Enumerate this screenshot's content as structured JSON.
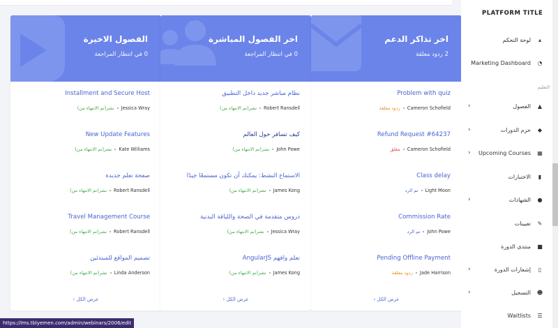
{
  "sidebar": {
    "title": "PLATFORM TITLE",
    "section_label": "التعليم",
    "items": [
      {
        "label": "لوحة التحكم",
        "icon": "dashboard-icon",
        "chevron": false
      },
      {
        "label": "Marketing Dashboard",
        "icon": "pie-chart-icon",
        "chevron": false
      },
      {
        "label": "الفصول",
        "icon": "graduation-cap-icon",
        "chevron": true
      },
      {
        "label": "حزم الدورات",
        "icon": "cube-icon",
        "chevron": true
      },
      {
        "label": "Upcoming Courses",
        "icon": "calendar-icon",
        "chevron": true
      },
      {
        "label": "الاختبارات",
        "icon": "file-icon",
        "chevron": false
      },
      {
        "label": "الشهادات",
        "icon": "certificate-icon",
        "chevron": true
      },
      {
        "label": "تعيينات",
        "icon": "pen-icon",
        "chevron": false
      },
      {
        "label": "منتدى الدورة",
        "icon": "comment-icon",
        "chevron": false
      },
      {
        "label": "إشعارات الدورة",
        "icon": "clipboard-icon",
        "chevron": true
      },
      {
        "label": "التسجيل",
        "icon": "user-plus-icon",
        "chevron": true
      },
      {
        "label": "Waitlists",
        "icon": "list-icon",
        "chevron": false
      }
    ]
  },
  "cards": [
    {
      "title": "اخر تذاكر الدعم",
      "subtitle": "2 ردود معلقة",
      "deco_icon": "envelope-icon",
      "view_all": "عرض الكل",
      "items": [
        {
          "title": "Problem with quiz",
          "person": "Cameron Schofield",
          "status": "ردود معلقة",
          "status_class": "st-orange"
        },
        {
          "title": "Refund Request #64237",
          "person": "Cameron Schofield",
          "status": "مغلق",
          "status_class": "st-red"
        },
        {
          "title": "Class delay",
          "person": "Light Moon",
          "status": "تم الرد",
          "status_class": "st-blue"
        },
        {
          "title": "Commission Rate",
          "person": "John Powe",
          "status": "تم الرد",
          "status_class": "st-blue"
        },
        {
          "title": "Pending Offline Payment",
          "person": "Jade Harrison",
          "status": "ردود معلقة",
          "status_class": "st-orange"
        }
      ]
    },
    {
      "title": "اخر الفصول المباشرة",
      "subtitle": "0 في انتظار المراجعة",
      "deco_icon": "users-icon",
      "view_all": "عرض الكل",
      "items": [
        {
          "title": "نظام مباشر جديد داخل التطبيق",
          "person": "Robert Ransdell",
          "status": "نشر(تم الانتهاء من)",
          "status_class": "st-green"
        },
        {
          "title": "كيف تسافر حول العالم",
          "person": "John Powe",
          "status": "نشر(تم الانتهاء من)",
          "status_class": "st-green"
        },
        {
          "title": "الاستماع النشط: يمكنك أن تكون مستمعًا جيدًا",
          "person": "James Kong",
          "status": "نشر(تم الانتهاء من)",
          "status_class": "st-green"
        },
        {
          "title": "دروس متقدمة في الصحة واللياقة البدنية",
          "person": "Jessica Wray",
          "status": "نشر(تم الانتهاء من)",
          "status_class": "st-green"
        },
        {
          "title": "تعلم وافهم AngularJS",
          "person": "James Kong",
          "status": "نشر(تم الانتهاء من)",
          "status_class": "st-green"
        }
      ]
    },
    {
      "title": "الفصول الاخيرة",
      "subtitle": "0 في انتظار المراجعة",
      "deco_icon": "play-icon",
      "view_all": "عرض الكل",
      "items": [
        {
          "title": "Installment and Secure Host",
          "person": "Jessica Wray",
          "status": "نشر(تم الانتهاء من)",
          "status_class": "st-green"
        },
        {
          "title": "New Update Features",
          "person": "Kate Williams",
          "status": "نشر(تم الانتهاء من)",
          "status_class": "st-green"
        },
        {
          "title": "صفحة تعلم جديدة",
          "person": "Robert Ransdell",
          "status": "نشر(تم الانتهاء من)",
          "status_class": "st-green"
        },
        {
          "title": "Travel Management Course",
          "person": "Robert Ransdell",
          "status": "نشر(تم الانتهاء من)",
          "status_class": "st-green"
        },
        {
          "title": "تصميم المواقع للمبتدئين",
          "person": "Linda Anderson",
          "status": "نشر(تم الانتهاء من)",
          "status_class": "st-green"
        }
      ]
    }
  ],
  "status_bar": {
    "url": "https://lms.tblyemen.com/admin/webinars/2006/edit"
  },
  "colors": {
    "card_header": "#6b84ea",
    "link": "#4a63d0",
    "published": "#41a84a",
    "pending": "#f08a24",
    "closed": "#e04848"
  }
}
